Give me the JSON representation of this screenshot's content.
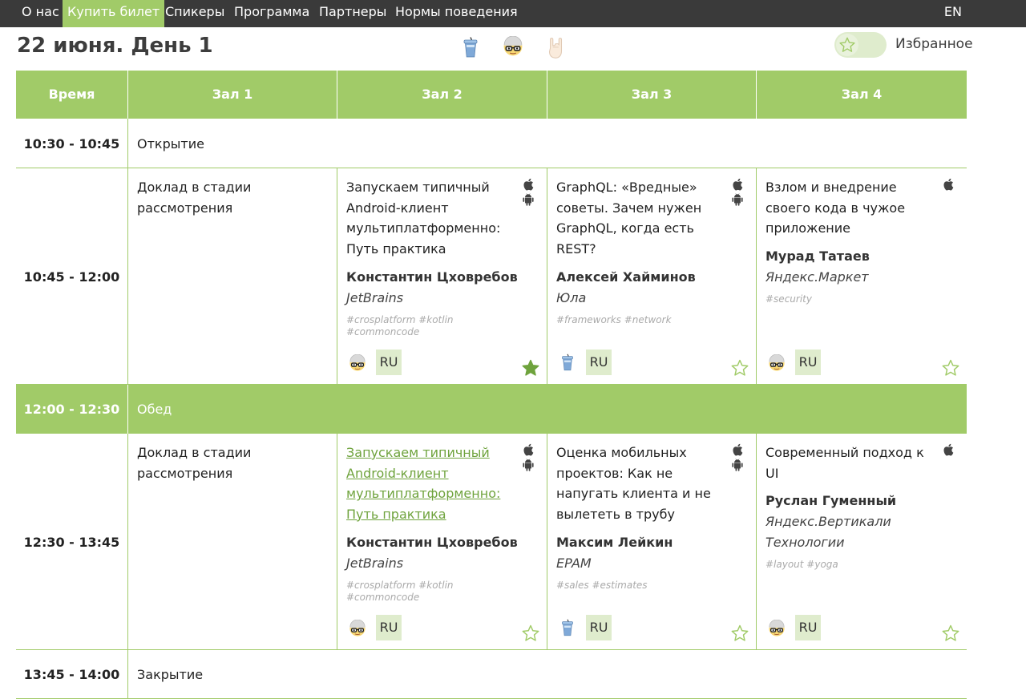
{
  "nav": {
    "items": [
      "О нас",
      "Купить билет",
      "Спикеры",
      "Программа",
      "Партнеры",
      "Нормы поведения"
    ],
    "lang": "EN"
  },
  "header": {
    "title": "22 июня. День 1",
    "filters": [
      "cup-icon",
      "nerd-icon",
      "rock-hand-icon"
    ],
    "favorites_label": "Избранное"
  },
  "colors": {
    "accent": "#a1cb68",
    "accent_light": "#dfeccd",
    "nav_bg": "#3a3a3a",
    "link": "#6fa33d"
  },
  "table": {
    "headers": [
      "Время",
      "Зал 1",
      "Зал 2",
      "Зал 3",
      "Зал 4"
    ],
    "opening": {
      "time": "10:30 - 10:45",
      "label": "Открытие"
    },
    "slot1": {
      "time": "10:45 - 12:00",
      "hall1": "Доклад в стадии рассмотрения",
      "hall2": {
        "title": "Запускаем типичный Android-клиент мультиплатформенно: Путь практика",
        "speaker": "Константин Цховребов",
        "company": "JetBrains",
        "tags": "#crosplatform  #kotlin  #commoncode",
        "lang": "RU",
        "platforms": [
          "apple-icon",
          "android-icon"
        ],
        "level": "nerd-icon",
        "favorite": true
      },
      "hall3": {
        "title": "GraphQL: «Вредные» советы. Зачем нужен GraphQL, когда есть REST?",
        "speaker": "Алексей Хайминов",
        "company": "Юла",
        "tags": "#frameworks  #network",
        "lang": "RU",
        "platforms": [
          "apple-icon",
          "android-icon"
        ],
        "level": "cup-icon",
        "favorite": false
      },
      "hall4": {
        "title": "Взлом и внедрение своего кода в чужое приложение",
        "speaker": "Мурад Татаев",
        "company": "Яндекс.Маркет",
        "tags": "#security",
        "lang": "RU",
        "platforms": [
          "apple-icon"
        ],
        "level": "nerd-icon",
        "favorite": false
      }
    },
    "lunch": {
      "time": "12:00 - 12:30",
      "label": "Обед"
    },
    "slot2": {
      "time": "12:30 - 13:45",
      "hall1": "Доклад в стадии рассмотрения",
      "hall2": {
        "title": "Запускаем типичный Android-клиент мультиплатформенно: Путь практика",
        "speaker": "Константин Цховребов",
        "company": "JetBrains",
        "tags": "#crosplatform  #kotlin  #commoncode",
        "lang": "RU",
        "platforms": [
          "apple-icon",
          "android-icon"
        ],
        "level": "nerd-icon",
        "favorite": false
      },
      "hall3": {
        "title": "Оценка мобильных проектов: Как не напугать клиента и не вылететь в трубу",
        "speaker": "Максим Лейкин",
        "company": "EPAM",
        "tags": "#sales  #estimates",
        "lang": "RU",
        "platforms": [
          "apple-icon",
          "android-icon"
        ],
        "level": "cup-icon",
        "favorite": false
      },
      "hall4": {
        "title": "Современный подход к UI",
        "speaker": "Руслан Гуменный",
        "company": "Яндекс.Вертикали Технологии",
        "tags": "#layout  #yoga",
        "lang": "RU",
        "platforms": [
          "apple-icon"
        ],
        "level": "nerd-icon",
        "favorite": false
      }
    },
    "closing": {
      "time": "13:45 - 14:00",
      "label": "Закрытие"
    }
  }
}
